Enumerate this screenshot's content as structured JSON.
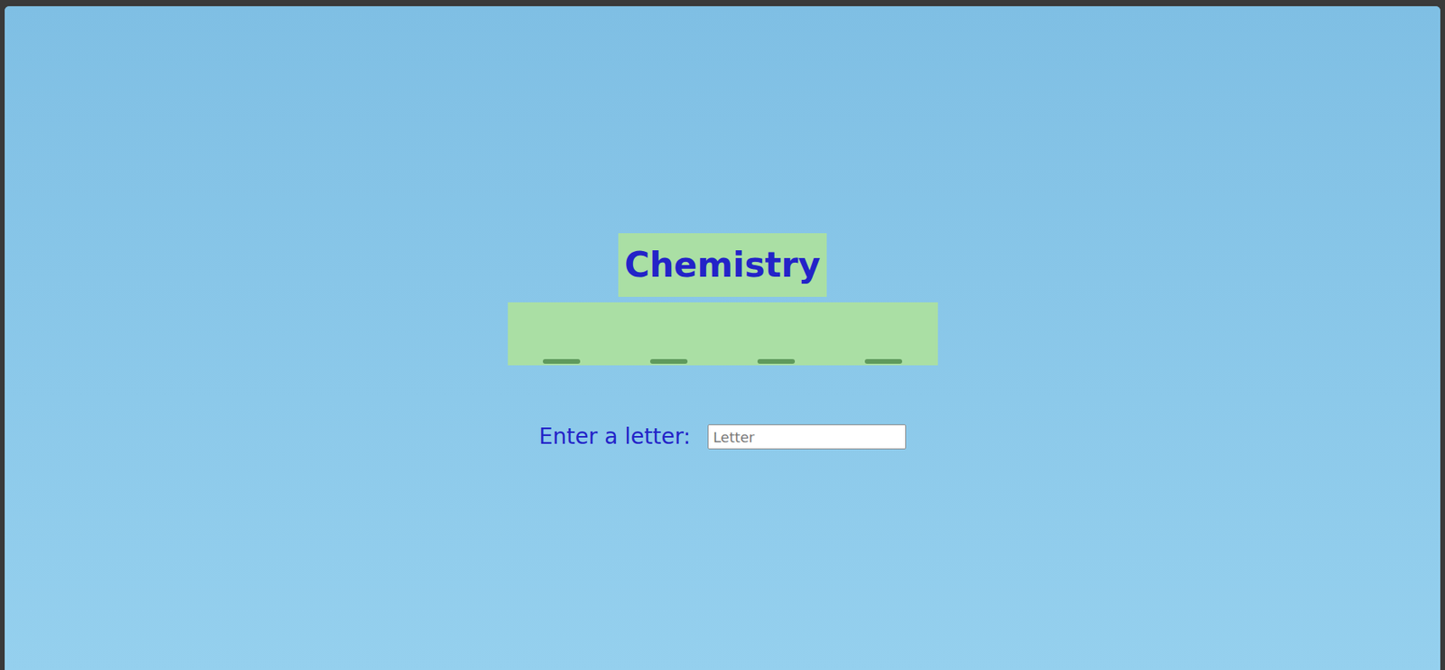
{
  "title": "Chemistry",
  "word": {
    "slots": [
      {
        "revealed": false
      },
      {
        "revealed": false
      },
      {
        "revealed": false
      },
      {
        "revealed": false
      }
    ]
  },
  "guess": {
    "label": "Enter a letter:",
    "placeholder": "Letter"
  }
}
